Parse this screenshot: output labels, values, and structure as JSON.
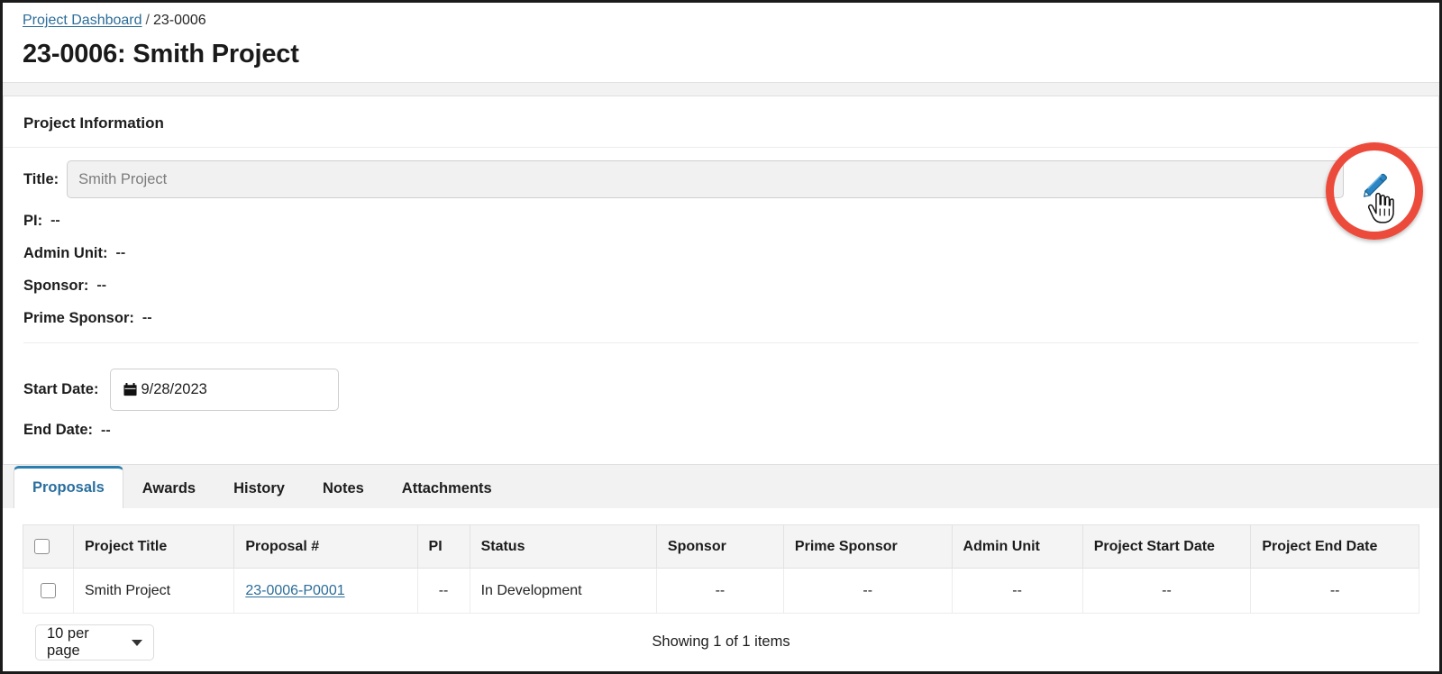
{
  "breadcrumb": {
    "link_label": "Project Dashboard",
    "separator": "/",
    "current": "23-0006"
  },
  "page_title": "23-0006: Smith Project",
  "card": {
    "heading": "Project Information",
    "fields": {
      "title_label": "Title:",
      "title_value": "Smith Project",
      "title_placeholder": "Smith Project",
      "pi_label": "PI:",
      "pi_value": "--",
      "admin_unit_label": "Admin Unit:",
      "admin_unit_value": "--",
      "sponsor_label": "Sponsor:",
      "sponsor_value": "--",
      "prime_sponsor_label": "Prime Sponsor:",
      "prime_sponsor_value": "--",
      "start_date_label": "Start Date:",
      "start_date_value": "9/28/2023",
      "end_date_label": "End Date:",
      "end_date_value": "--"
    },
    "edit_icon": "pencil-edit-icon",
    "calendar_icon": "calendar-icon",
    "annotation_color": "#ec4b3b",
    "accent_color": "#2a7fae",
    "link_color": "#2b6d99"
  },
  "tabs": [
    {
      "label": "Proposals",
      "active": true
    },
    {
      "label": "Awards",
      "active": false
    },
    {
      "label": "History",
      "active": false
    },
    {
      "label": "Notes",
      "active": false
    },
    {
      "label": "Attachments",
      "active": false
    }
  ],
  "table": {
    "columns": [
      "Project Title",
      "Proposal #",
      "PI",
      "Status",
      "Sponsor",
      "Prime Sponsor",
      "Admin Unit",
      "Project Start Date",
      "Project End Date"
    ],
    "rows": [
      {
        "project_title": "Smith Project",
        "proposal_number": "23-0006-P0001",
        "pi": "--",
        "status": "In Development",
        "sponsor": "--",
        "prime_sponsor": "--",
        "admin_unit": "--",
        "project_start_date": "--",
        "project_end_date": "--"
      }
    ]
  },
  "footer": {
    "per_page": "10 per page",
    "showing": "Showing 1 of 1 items"
  }
}
